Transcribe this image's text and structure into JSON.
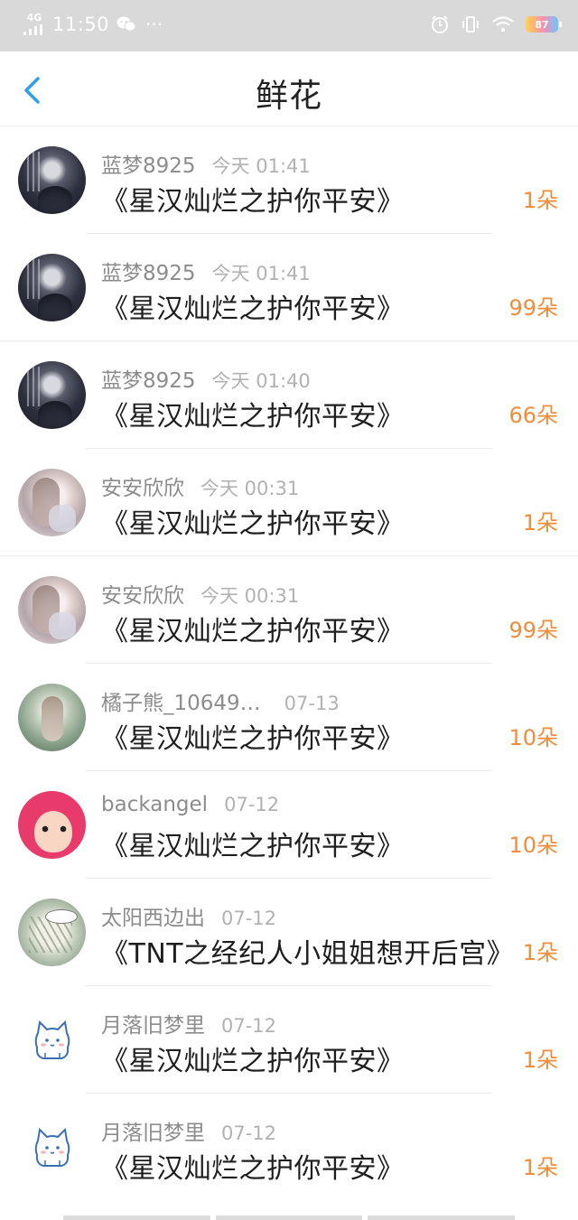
{
  "status_bar": {
    "network": "4G",
    "time": "11:50",
    "more": "···",
    "battery": "87"
  },
  "header": {
    "title": "鲜花"
  },
  "colors": {
    "accent": "#2b9ff0",
    "count": "#f08c3a",
    "status_bar": "#d9d9d9"
  },
  "items": [
    {
      "username": "蓝梦8925",
      "time": "今天 01:41",
      "book": "《星汉灿烂之护你平安》",
      "count": "1朵",
      "avatar": "dark"
    },
    {
      "username": "蓝梦8925",
      "time": "今天 01:41",
      "book": "《星汉灿烂之护你平安》",
      "count": "99朵",
      "avatar": "dark"
    },
    {
      "username": "蓝梦8925",
      "time": "今天 01:40",
      "book": "《星汉灿烂之护你平安》",
      "count": "66朵",
      "avatar": "dark"
    },
    {
      "username": "安安欣欣",
      "time": "今天 00:31",
      "book": "《星汉灿烂之护你平安》",
      "count": "1朵",
      "avatar": "light"
    },
    {
      "username": "安安欣欣",
      "time": "今天 00:31",
      "book": "《星汉灿烂之护你平安》",
      "count": "99朵",
      "avatar": "light"
    },
    {
      "username": "橘子熊_10649…",
      "time": "07-13",
      "book": "《星汉灿烂之护你平安》",
      "count": "10朵",
      "avatar": "green"
    },
    {
      "username": "backangel",
      "time": "07-12",
      "book": "《星汉灿烂之护你平安》",
      "count": "10朵",
      "avatar": "cartoon"
    },
    {
      "username": "太阳西边出",
      "time": "07-12",
      "book": "《TNT之经纪人小姐姐想开后宫》",
      "count": "1朵",
      "avatar": "sketch"
    },
    {
      "username": "月落旧梦里",
      "time": "07-12",
      "book": "《星汉灿烂之护你平安》",
      "count": "1朵",
      "avatar": "cat"
    },
    {
      "username": "月落旧梦里",
      "time": "07-12",
      "book": "《星汉灿烂之护你平安》",
      "count": "1朵",
      "avatar": "cat"
    }
  ]
}
